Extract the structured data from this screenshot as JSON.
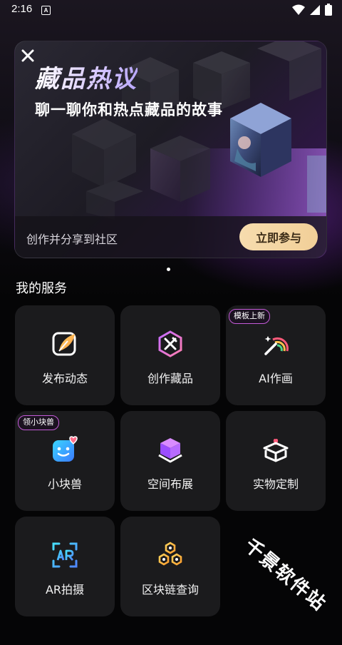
{
  "status_bar": {
    "time": "2:16",
    "notification_letter": "A",
    "icons": [
      "wifi-icon",
      "signal-icon",
      "battery-icon"
    ]
  },
  "banner": {
    "title": "藏品热议",
    "subtitle": "聊一聊你和热点藏品的故事",
    "cta_text": "创作并分享到社区",
    "button_label": "立即参与",
    "page_count": 1,
    "active_page": 1
  },
  "services": {
    "title": "我的服务",
    "items": [
      {
        "label": "发布动态",
        "icon": "feather-pen-icon",
        "badge": ""
      },
      {
        "label": "创作藏品",
        "icon": "creation-hexagon-icon",
        "badge": ""
      },
      {
        "label": "AI作画",
        "icon": "magic-wand-rainbow-icon",
        "badge": "模板上新"
      },
      {
        "label": "小块兽",
        "icon": "smiley-square-heart-icon",
        "badge": "领小块兽"
      },
      {
        "label": "空间布展",
        "icon": "cube-icon",
        "badge": ""
      },
      {
        "label": "实物定制",
        "icon": "gift-box-heart-icon",
        "badge": ""
      },
      {
        "label": "AR拍摄",
        "icon": "ar-scan-icon",
        "badge": ""
      },
      {
        "label": "区块链查询",
        "icon": "hexagon-chain-icon",
        "badge": ""
      }
    ]
  },
  "watermark": "千景软件站",
  "colors": {
    "background": "#050506",
    "tile": "#1b1b1d",
    "button": "#f4d6a4",
    "badge_border": "#c45bd8"
  }
}
